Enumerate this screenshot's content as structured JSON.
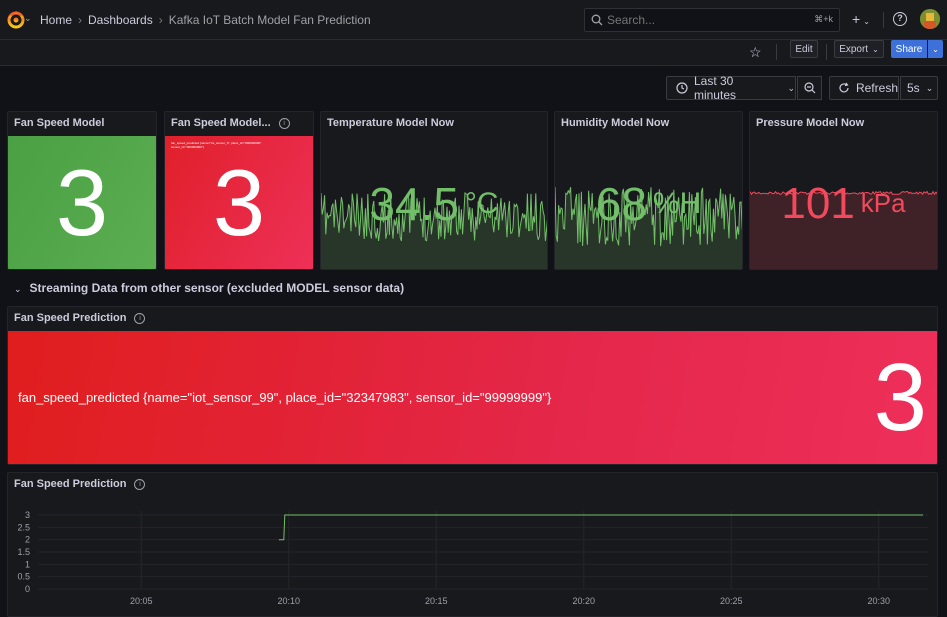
{
  "nav": {
    "breadcrumbs": [
      "Home",
      "Dashboards",
      "Kafka IoT Batch Model Fan Prediction"
    ],
    "search_placeholder": "Search...",
    "search_shortcut": "⌘+k"
  },
  "toolbar": {
    "edit": "Edit",
    "export": "Export",
    "share": "Share"
  },
  "timepicker": {
    "range": "Last 30 minutes",
    "refresh": "Refresh",
    "interval": "5s"
  },
  "panels": {
    "fan_speed_model": {
      "title": "Fan Speed Model",
      "value": "3",
      "color": "#56a64b"
    },
    "fan_speed_model_2": {
      "title": "Fan Speed Model...",
      "value": "3",
      "color": "#e02f44",
      "series_label": "fan_speed_predicted {name=\"iot_sensor_0\", place_id=\"000000000\", sensor_id=\"000000000\"}"
    },
    "temperature": {
      "title": "Temperature Model Now",
      "value": "34.5",
      "unit": "°C",
      "color": "#73bf69"
    },
    "humidity": {
      "title": "Humidity Model Now",
      "value": "68",
      "unit": "%H",
      "color": "#73bf69"
    },
    "pressure": {
      "title": "Pressure Model Now",
      "value": "101",
      "unit": "kPa",
      "color": "#f2495c"
    }
  },
  "row": {
    "title": "Streaming Data from other sensor (excluded MODEL sensor data)"
  },
  "prediction_stat": {
    "title": "Fan Speed Prediction",
    "label": "fan_speed_predicted {name=\"iot_sensor_99\", place_id=\"32347983\", sensor_id=\"99999999\"}",
    "value": "3"
  },
  "prediction_chart": {
    "title": "Fan Speed Prediction",
    "series_color": "#73bf69"
  },
  "chart_data": {
    "type": "line",
    "x_ticks": [
      "20:05",
      "20:10",
      "20:15",
      "20:20",
      "20:25",
      "20:30"
    ],
    "y_ticks": [
      "3",
      "2.5",
      "2",
      "1.5",
      "1",
      "0.5",
      "0"
    ],
    "ylim": [
      0,
      3
    ],
    "series": [
      {
        "x": [
          "20:09:40",
          "20:09:50",
          "20:09:52",
          "20:31:30"
        ],
        "values": [
          2,
          2,
          3,
          3
        ]
      }
    ]
  }
}
